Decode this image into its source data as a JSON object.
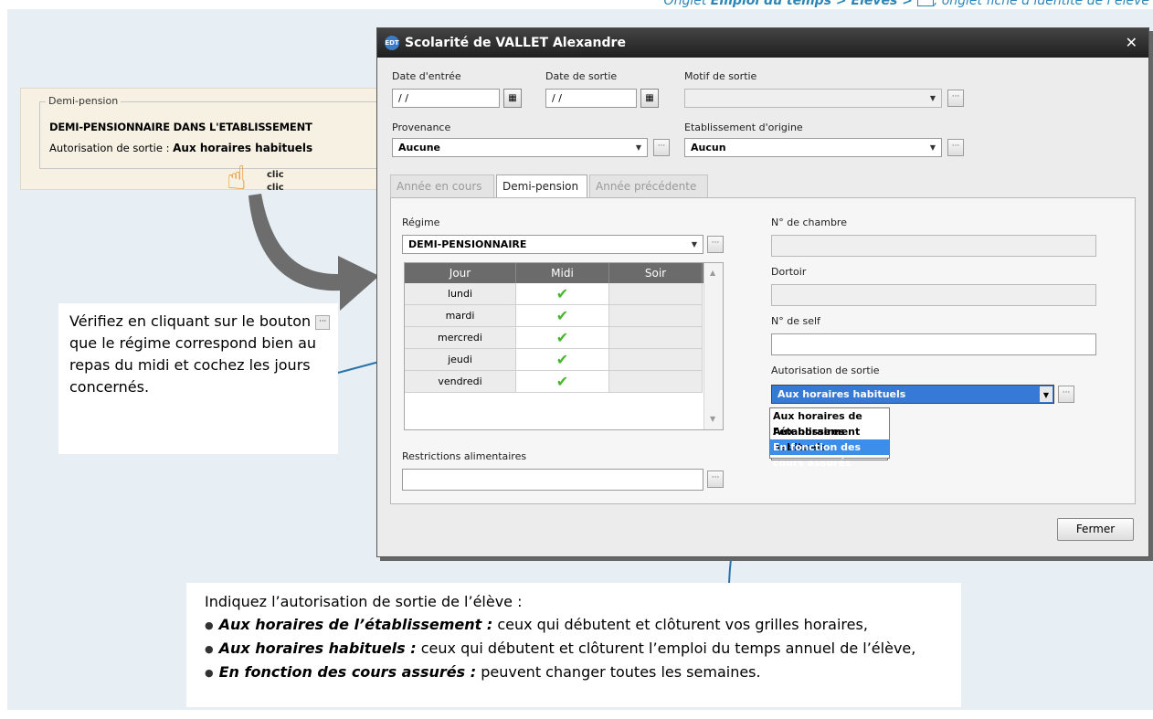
{
  "breadcrumb": {
    "prefix": "Onglet ",
    "bold": "Emploi du temps > Élèves > ",
    "suffix": ", onglet fiche d’identité de l’élève"
  },
  "demi_panel": {
    "legend": "Demi-pension",
    "title": "DEMI-PENSIONNAIRE DANS L'ETABLISSEMENT",
    "auth_label": "Autorisation de sortie : ",
    "auth_value": "Aux horaires habituels",
    "clic1": "clic",
    "clic2": "clic"
  },
  "dialog": {
    "title": "Scolarité de VALLET Alexandre",
    "labels": {
      "date_entree": "Date d'entrée",
      "date_sortie": "Date de sortie",
      "motif_sortie": "Motif de sortie",
      "provenance": "Provenance",
      "etablissement_origine": "Etablissement d'origine"
    },
    "values": {
      "date_entree": "/ /",
      "date_sortie": "/ /",
      "motif_sortie": "",
      "provenance": "Aucune",
      "etablissement_origine": "Aucun"
    },
    "tabs": [
      "Année en cours",
      "Demi-pension",
      "Année précédente"
    ],
    "active_tab": "Demi-pension",
    "regime_label": "Régime",
    "regime_value": "DEMI-PENSIONNAIRE",
    "grid": {
      "columns": [
        "Jour",
        "Midi",
        "Soir"
      ],
      "rows": [
        {
          "jour": "lundi",
          "midi": "✔",
          "soir": ""
        },
        {
          "jour": "mardi",
          "midi": "✔",
          "soir": ""
        },
        {
          "jour": "mercredi",
          "midi": "✔",
          "soir": ""
        },
        {
          "jour": "jeudi",
          "midi": "✔",
          "soir": ""
        },
        {
          "jour": "vendredi",
          "midi": "✔",
          "soir": ""
        }
      ]
    },
    "restrictions_label": "Restrictions alimentaires",
    "restrictions_value": "",
    "chambre_label": "N° de chambre",
    "dortoir_label": "Dortoir",
    "self_label": "N° de self",
    "autorisation_label": "Autorisation de sortie",
    "autorisation_value": "Aux horaires habituels",
    "autorisation_options": [
      "Aux horaires de l'établissement",
      "Aux horaires habituels",
      "En fonction des cours assurés"
    ],
    "dots": "···",
    "close_label": "Fermer",
    "close_x": "✕"
  },
  "callout_left": {
    "text_before": "Vérifiez en cliquant sur le bouton ",
    "text_after": " que le régime correspond bien au repas du midi et cochez les jours concernés."
  },
  "callout_bottom": {
    "intro": "Indiquez l’autorisation de sortie de l’élève :",
    "items": [
      {
        "bold": "Aux horaires de l’établissement :",
        "text": " ceux qui débutent et clôturent vos grilles horaires,"
      },
      {
        "bold": "Aux horaires habituels :",
        "text": " ceux qui débutent et clôturent l’emploi du temps annuel de l’élève,"
      },
      {
        "bold": "En fonction des cours assurés :",
        "text": " peuvent changer toutes les semaines."
      }
    ]
  },
  "colors": {
    "accent": "#2b86b6",
    "background": "#e7eef4",
    "selection": "#3d8ee8",
    "check": "#47b52c"
  }
}
